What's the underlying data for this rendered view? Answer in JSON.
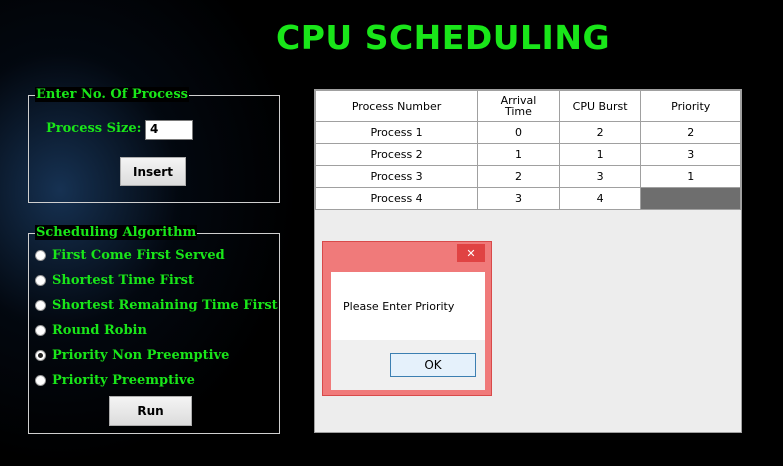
{
  "title": "CPU SCHEDULING",
  "process_group": {
    "legend": "Enter No. Of Process",
    "size_label": "Process Size:",
    "size_value": "4",
    "insert_label": "Insert"
  },
  "algorithm_group": {
    "legend": "Scheduling Algorithm",
    "options": [
      {
        "label": "First Come First Served",
        "checked": false
      },
      {
        "label": "Shortest Time First",
        "checked": false
      },
      {
        "label": "Shortest Remaining Time First",
        "checked": false
      },
      {
        "label": "Round Robin",
        "checked": false
      },
      {
        "label": "Priority Non Preemptive",
        "checked": true
      },
      {
        "label": "Priority Preemptive",
        "checked": false
      }
    ],
    "run_label": "Run"
  },
  "grid": {
    "columns": [
      "Process Number",
      "Arrival Time",
      "CPU Burst",
      "Priority"
    ],
    "rows": [
      [
        "Process 1",
        "0",
        "2",
        "2"
      ],
      [
        "Process 2",
        "1",
        "1",
        "3"
      ],
      [
        "Process 3",
        "2",
        "3",
        "1"
      ],
      [
        "Process 4",
        "3",
        "4",
        ""
      ]
    ]
  },
  "dialog": {
    "close_glyph": "✕",
    "message": "Please Enter Priority",
    "ok_label": "OK"
  },
  "colors": {
    "accent_green": "#19e619",
    "background": "#000000",
    "dialog_frame": "#f07a7a"
  }
}
